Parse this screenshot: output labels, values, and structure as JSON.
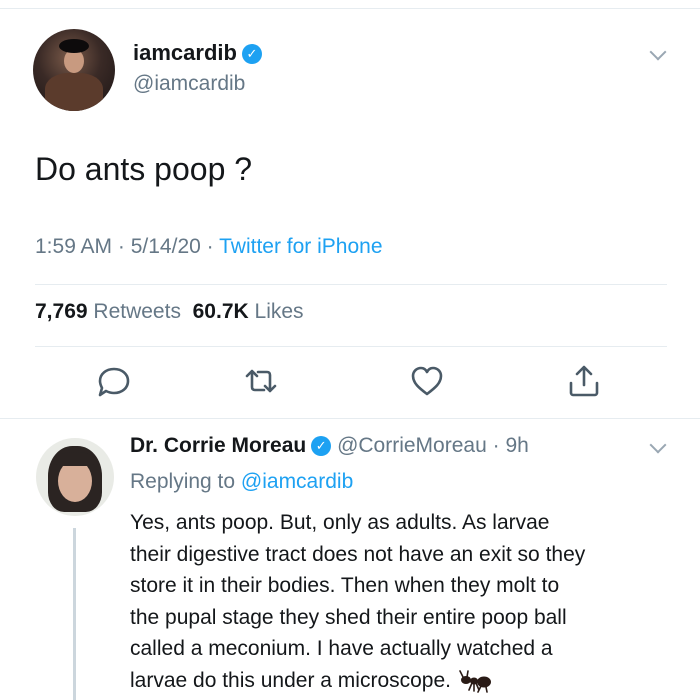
{
  "tweet": {
    "display_name": "iamcardib",
    "handle": "@iamcardib",
    "text": "Do ants poop ?",
    "time": "1:59 AM",
    "date": "5/14/20",
    "source": "Twitter for iPhone",
    "retweets_count": "7,769",
    "retweets_label": "Retweets",
    "likes_count": "60.7K",
    "likes_label": "Likes",
    "verified_icon": "verified-check-icon",
    "menu_icon": "chevron-down-icon"
  },
  "actions": {
    "reply_icon": "reply-icon",
    "retweet_icon": "retweet-icon",
    "like_icon": "heart-icon",
    "share_icon": "share-icon"
  },
  "reply": {
    "display_name": "Dr. Corrie Moreau",
    "handle": "@CorrieMoreau",
    "time": "9h",
    "replying_prefix": "Replying to",
    "replying_to": "@iamcardib",
    "lines": [
      "Yes, ants poop. But, only as adults. As larvae",
      "their digestive tract does not have an exit so they",
      "store it in their bodies. Then when they molt to",
      "the pupal stage they shed their entire poop ball",
      "called a meconium. I have actually watched a",
      "larvae do this under a microscope."
    ],
    "emoji": "ant-emoji"
  },
  "colors": {
    "accent": "#1da1f2",
    "muted": "#657786",
    "text": "#14171a",
    "divider": "#e6ecf0"
  }
}
